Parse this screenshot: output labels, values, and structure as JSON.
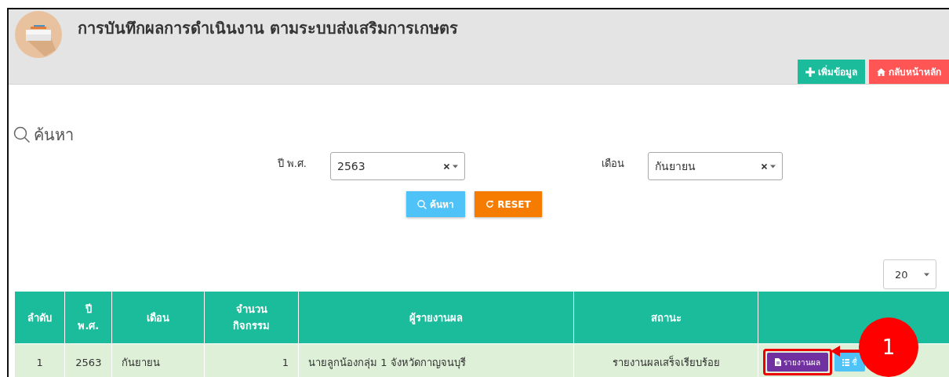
{
  "header": {
    "title": "การบันทึกผลการดำเนินงาน ตามระบบส่งเสริมการเกษตร",
    "buttons": [
      {
        "kind": "add",
        "label": "เพิ่มข้อมูล"
      },
      {
        "kind": "home",
        "label": "กลับหน้าหลัก"
      }
    ]
  },
  "search": {
    "heading": "ค้นหา",
    "fields": [
      {
        "label": "ปี พ.ศ.",
        "value": "2563"
      },
      {
        "label": "เดือน",
        "value": "กันยายน"
      }
    ],
    "buttons": [
      {
        "kind": "search",
        "label": "ค้นหา"
      },
      {
        "kind": "reset",
        "label": "RESET"
      }
    ]
  },
  "page_size": "20",
  "table": {
    "columns": [
      "ลำดับ",
      "ปี\nพ.ศ.",
      "เดือน",
      "จำนวน\nกิจกรรม",
      "ผู้รายงานผล",
      "สถานะ",
      ""
    ],
    "rows": [
      {
        "cells": [
          "1",
          "2563",
          "กันยายน",
          "1",
          "นายลูกน้องกลุ่ม 1 จังหวัดกาญจนบุรี",
          "รายงานผลเสร็จเรียบร้อย"
        ],
        "actions": [
          {
            "kind": "report",
            "label": "รายงานผล",
            "highlighted": true
          },
          {
            "kind": "list",
            "label": "ชื่"
          }
        ]
      }
    ]
  },
  "callout": {
    "number": "1"
  }
}
